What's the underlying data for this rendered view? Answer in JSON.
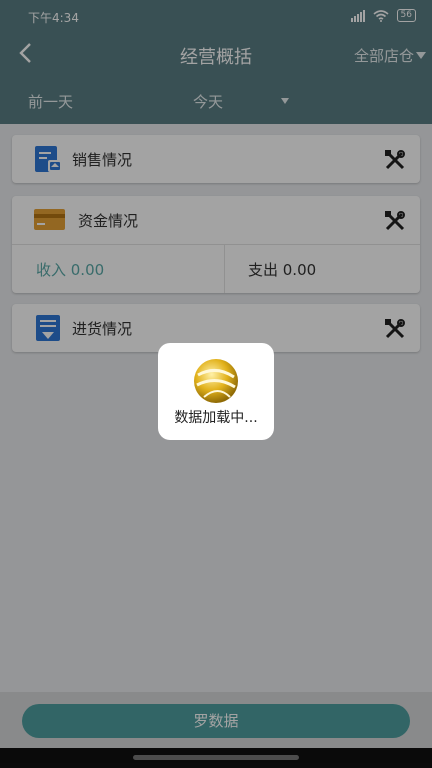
{
  "status": {
    "time": "下午4:34",
    "battery": "56"
  },
  "nav": {
    "title": "经营概括",
    "store": "全部店仓"
  },
  "datebar": {
    "prev": "前一天",
    "today": "今天"
  },
  "sections": {
    "sales": "销售情况",
    "funds": "资金情况",
    "income": "收入 0.00",
    "expense": "支出 0.00",
    "purchase": "进货情况"
  },
  "loading": {
    "text": "数据加载中..."
  },
  "bottom": {
    "button_text": "罗数据"
  },
  "colors": {
    "header": "#5a7e84",
    "accent": "#5aa9a8",
    "icon_blue": "#2e78d6",
    "icon_orange": "#e7a136"
  }
}
